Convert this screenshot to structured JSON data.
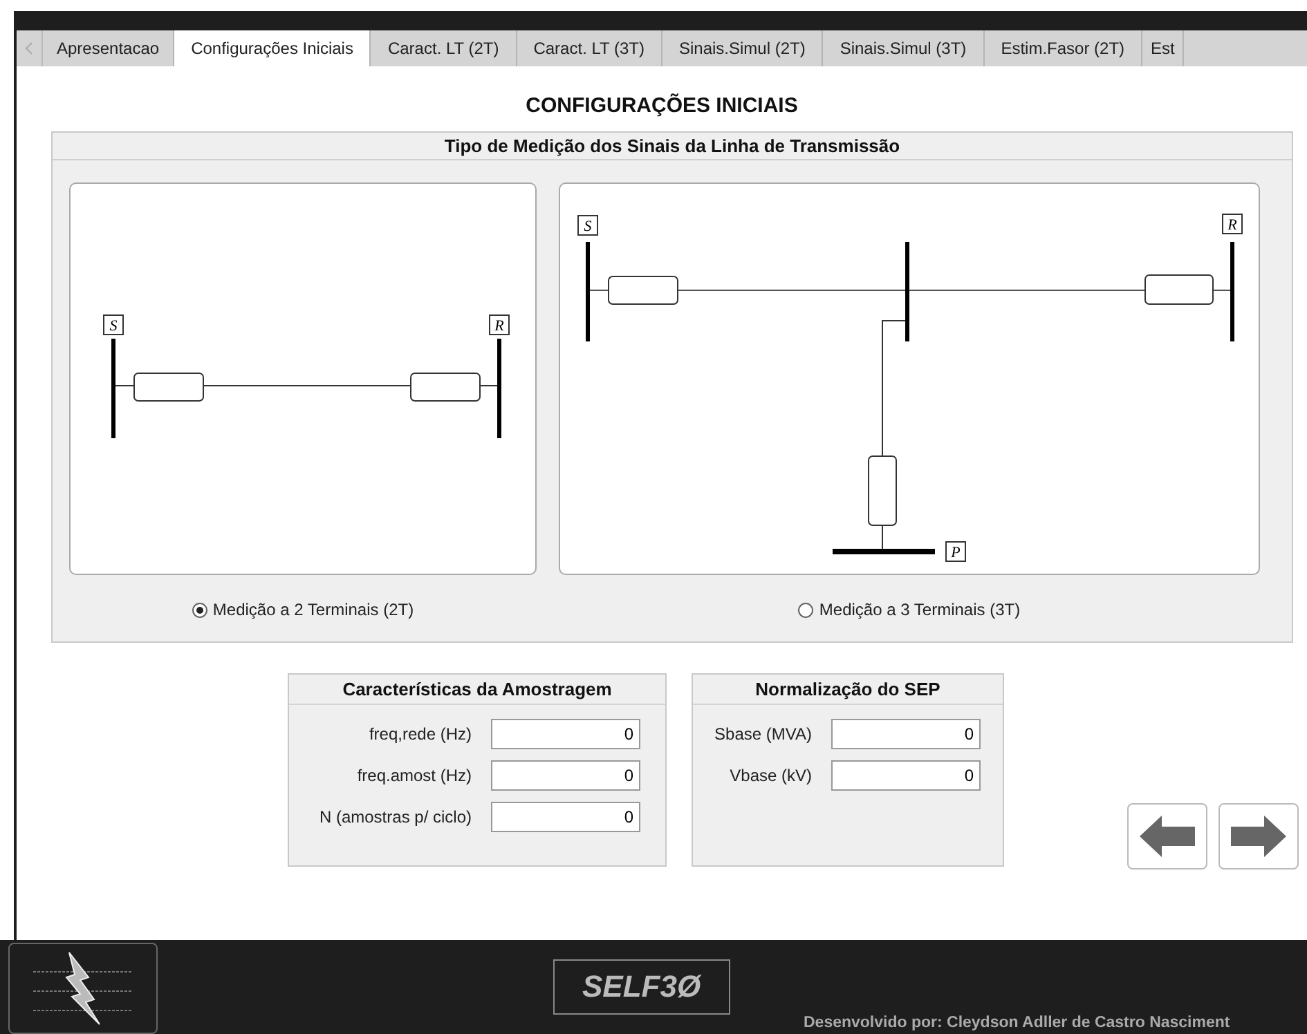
{
  "tabs": [
    {
      "label": "Apresentacao",
      "selected": false
    },
    {
      "label": "Configurações Iniciais",
      "selected": true
    },
    {
      "label": "Caract. LT (2T)",
      "selected": false
    },
    {
      "label": "Caract. LT (3T)",
      "selected": false
    },
    {
      "label": "Sinais.Simul (2T)",
      "selected": false
    },
    {
      "label": "Sinais.Simul (3T)",
      "selected": false
    },
    {
      "label": "Estim.Fasor (2T)",
      "selected": false
    },
    {
      "label": "Est",
      "selected": false
    }
  ],
  "page_title": "CONFIGURAÇÕES INICIAIS",
  "measurement_panel": {
    "title": "Tipo de Medição dos Sinais da Linha de Transmissão",
    "options": [
      {
        "kind": "two_terminal",
        "labels": [
          "S",
          "R"
        ],
        "radio": "Medição a 2 Terminais (2T)",
        "selected": true
      },
      {
        "kind": "three_terminal",
        "labels": [
          "S",
          "R",
          "P"
        ],
        "radio": "Medição a 3 Terminais (3T)",
        "selected": false
      }
    ]
  },
  "sampling": {
    "title": "Características da Amostragem",
    "fields": [
      {
        "label": "freq,rede (Hz)",
        "value": "0"
      },
      {
        "label": "freq.amost (Hz)",
        "value": "0"
      },
      {
        "label": "N (amostras p/ ciclo)",
        "value": "0"
      }
    ]
  },
  "normalization": {
    "title": "Normalização do SEP",
    "fields": [
      {
        "label": "Sbase (MVA)",
        "value": "0"
      },
      {
        "label": "Vbase (kV)",
        "value": "0"
      }
    ]
  },
  "footer": {
    "app_name": "SELF3Ø",
    "credit": "Desenvolvido por: Cleydson Adller de Castro Nasciment"
  }
}
